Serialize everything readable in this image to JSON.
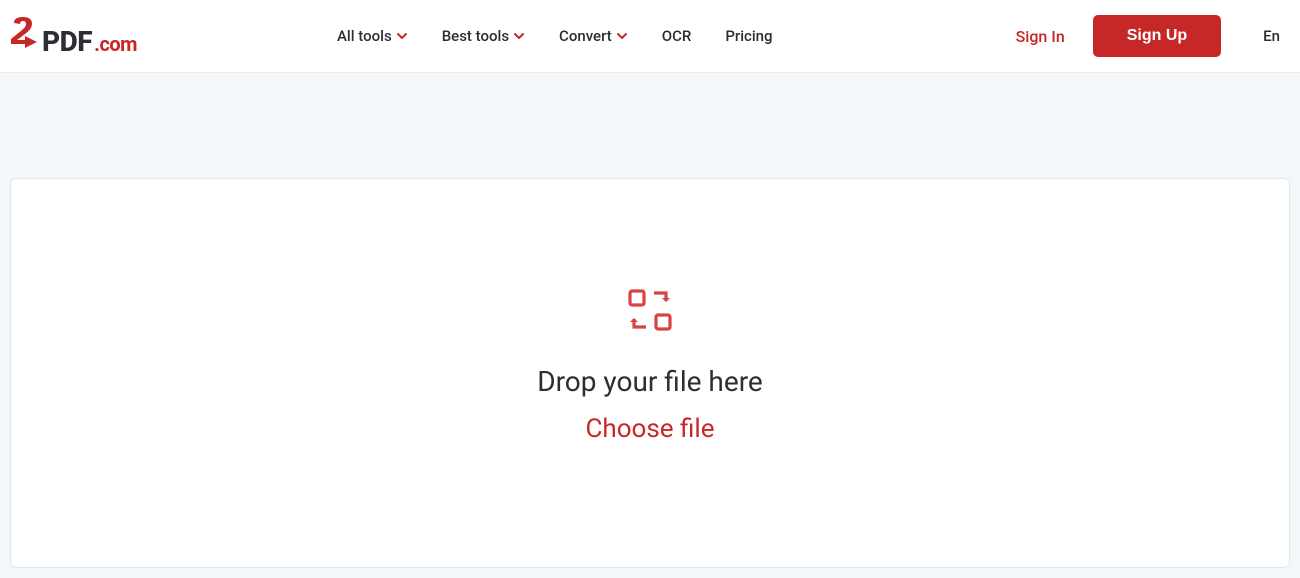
{
  "logo": {
    "pdf": "PDF",
    "com": ".com"
  },
  "nav": {
    "all_tools": "All tools",
    "best_tools": "Best tools",
    "convert": "Convert",
    "ocr": "OCR",
    "pricing": "Pricing"
  },
  "auth": {
    "signin": "Sign In",
    "signup": "Sign Up"
  },
  "lang": "En",
  "dropzone": {
    "drop_text": "Drop your file here",
    "choose_text": "Choose file"
  },
  "colors": {
    "brand_red": "#c62828",
    "text_dark": "#2b2f33",
    "page_bg": "#f4f7fa"
  }
}
